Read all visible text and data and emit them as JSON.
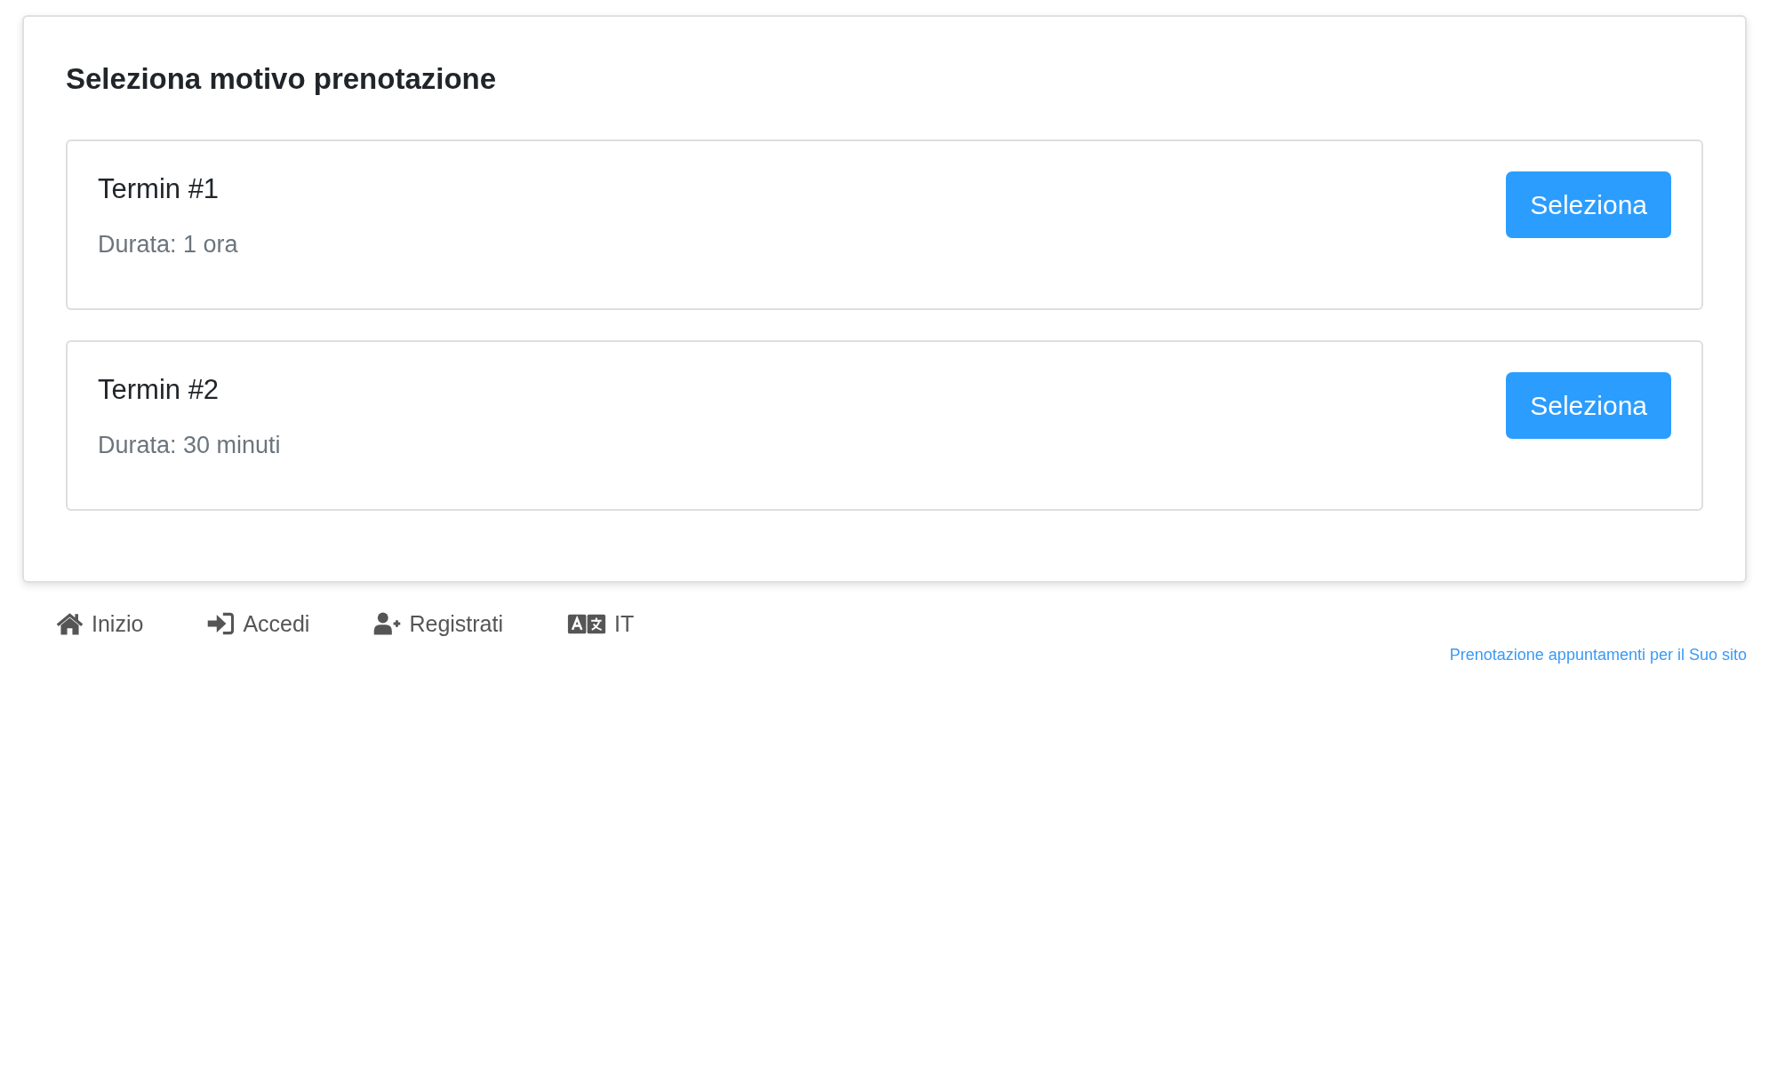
{
  "heading": "Seleziona motivo prenotazione",
  "services": [
    {
      "name": "Termin #1",
      "duration": "Durata: 1 ora",
      "button": "Seleziona"
    },
    {
      "name": "Termin #2",
      "duration": "Durata: 30 minuti",
      "button": "Seleziona"
    }
  ],
  "footer_nav": [
    {
      "kind": "home",
      "label": "Inizio"
    },
    {
      "kind": "login",
      "label": "Accedi"
    },
    {
      "kind": "register",
      "label": "Registrati"
    },
    {
      "kind": "language",
      "label": "IT"
    }
  ],
  "footer_link": "Prenotazione appuntamenti per il Suo sito"
}
